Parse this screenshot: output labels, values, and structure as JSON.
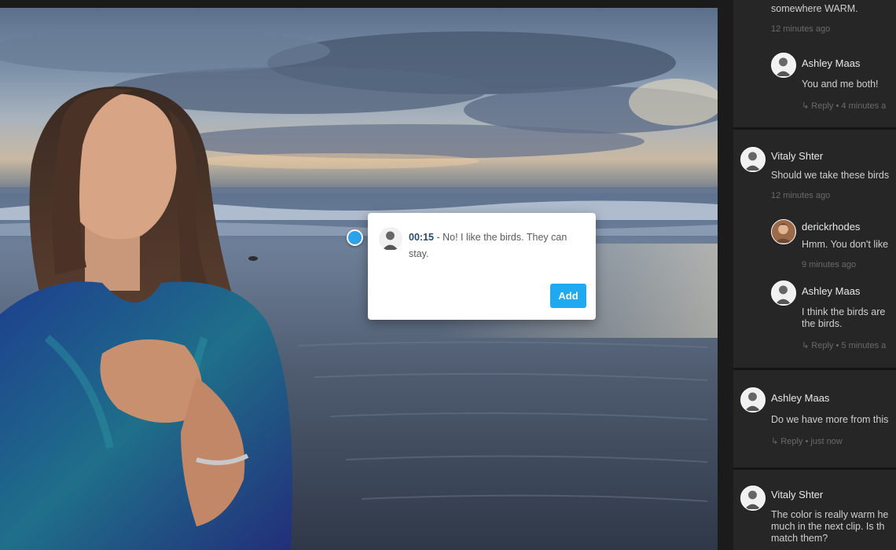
{
  "popup": {
    "timecode": "00:15",
    "separator": " - ",
    "comment": "No! I like the birds. They can stay.",
    "add_label": "Add"
  },
  "sidebar": {
    "threads": [
      {
        "top_text": "somewhere WARM.",
        "time": "12 minutes ago",
        "replies": [
          {
            "name": "Ashley Maas",
            "body": "You and me both!",
            "reply_label": "Reply",
            "time": "4 minutes a"
          }
        ]
      },
      {
        "name": "Vitaly Shter",
        "body": "Should we take these birds",
        "time": "12 minutes ago",
        "replies": [
          {
            "name": "derickrhodes",
            "body": "Hmm. You don't like",
            "time": "9 minutes ago"
          },
          {
            "name": "Ashley Maas",
            "body_line1": "I think the birds are",
            "body_line2": "the birds.",
            "reply_label": "Reply",
            "time": "5 minutes a"
          }
        ]
      },
      {
        "name": "Ashley Maas",
        "body": "Do we have more from this",
        "reply_label": "Reply",
        "time": "just now"
      },
      {
        "name": "Vitaly Shter",
        "body_line1": "The color is really warm he",
        "body_line2": "much in the next clip. Is th",
        "body_line3": "match them?"
      }
    ]
  },
  "colors": {
    "accent": "#1ea9f0",
    "sidebar_bg": "#1b1b1b",
    "thread_bg": "#262626"
  }
}
